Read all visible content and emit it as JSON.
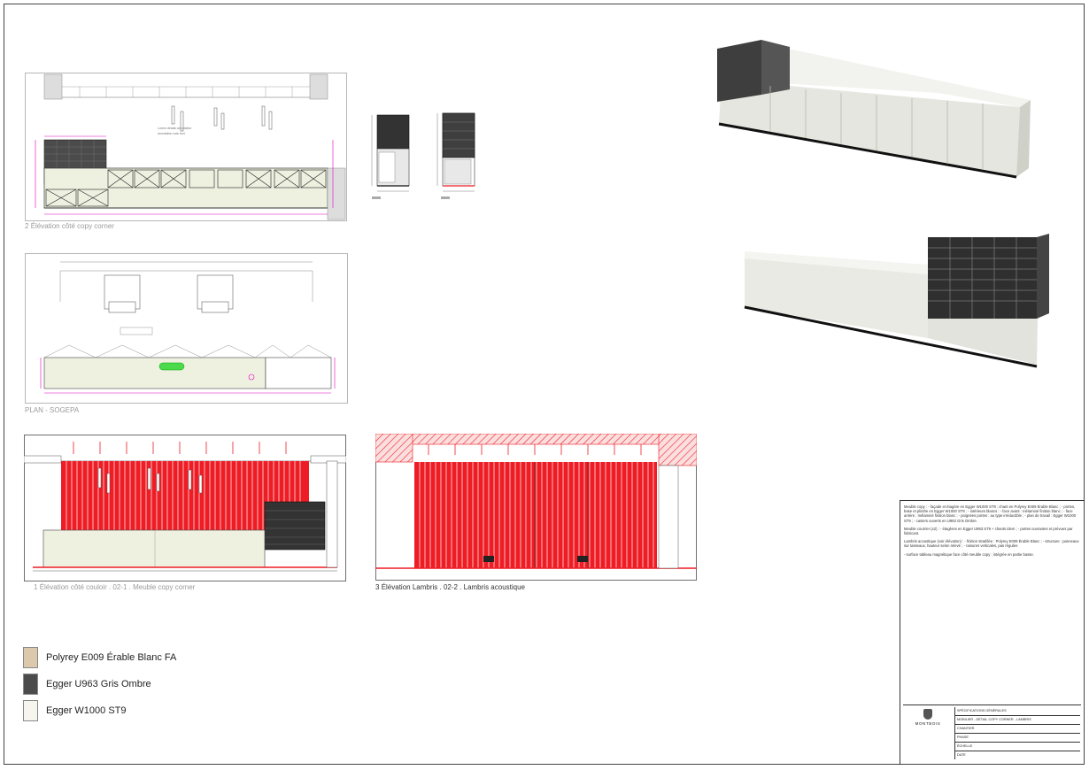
{
  "views": {
    "v2": {
      "caption": "Élévation côté copy corner",
      "num": "2"
    },
    "plan": {
      "caption": "PLAN - SOGEPA"
    },
    "v1": {
      "caption": "Élévation côté couloir . 02-1 . Meuble copy corner",
      "num": "1"
    },
    "v3": {
      "caption": "Élévation Lambris . 02-2 . Lambris acoustique",
      "num": "3"
    }
  },
  "legend": {
    "items": [
      {
        "label": "Polyrey E009 Érable Blanc FA",
        "color": "#dcc8aa"
      },
      {
        "label": "Egger U963 Gris Ombre",
        "color": "#4b4b4b"
      },
      {
        "label": "Egger W1000 ST9",
        "color": "#f6f6ee"
      }
    ]
  },
  "notes": {
    "blocks": [
      "Meuble copy : - façade et étagère en Egger W1000 ST9 ; chant en Polyrey E009 Érable Blanc ; - portes, base et plinthe en Egger W1000 ST9 ; - intérieurs blancs : - face avant : mélaminé finition blanc ; - face arrière : mélaminé finition blanc ; - poignées portes : au type irréductible ; - plan de travail : Egger W1000 ST9 ; - casiers ouverts en U963 Gris Ombre.",
      "Meuble courrier (x2) : - étagères en Egger U963 ST9 + chants idem ; - portes ouvrantes et prévues par fabricant.",
      "Lambris acoustique (voir élévation) : - finition stratifiée : Polyrey E009 Érable Blanc ; - structure : panneaux sur tasseaux, hauteur selon relevé ; - rainures verticales, pas régulier.",
      "- surface tableau magnétique face côté meuble copy ; intégrée en partie basse."
    ]
  },
  "title_block": {
    "company": "MONTBOIS",
    "rows": [
      "SPÉCIFICATIONS GÉNÉRALES",
      "MOBILIER - DÉTAIL COPY CORNER - LAMBRIS",
      "CHANTIER",
      "PHASE",
      "ÉCHELLE",
      "DATE"
    ]
  },
  "colors": {
    "accent_red": "#ee1c24",
    "dim_magenta": "#e600c8",
    "dark_grey": "#4b4b4b",
    "cream": "#eef0e0"
  }
}
